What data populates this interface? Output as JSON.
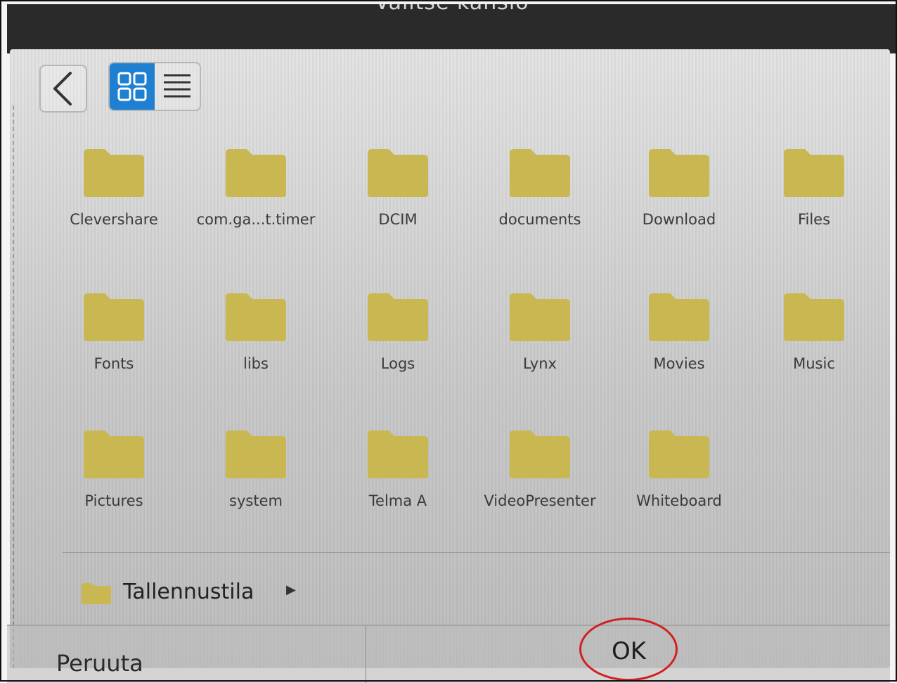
{
  "window": {
    "title": "Valitse kansio"
  },
  "toolbar": {
    "back_icon": "chevron-left-icon",
    "grid_view_icon": "grid-icon",
    "list_view_icon": "list-icon",
    "active_view": "grid"
  },
  "folders": [
    "Clevershare",
    "com.ga...t.timer",
    "DCIM",
    "documents",
    "Download",
    "Files",
    "Fonts",
    "libs",
    "Logs",
    "Lynx",
    "Movies",
    "Music",
    "Pictures",
    "system",
    "Telma A",
    "VideoPresenter",
    "Whiteboard"
  ],
  "path_bar": {
    "label": "Tallennustila",
    "icon": "folder-icon"
  },
  "footer": {
    "cancel_label": "Peruuta",
    "ok_label": "OK"
  },
  "colors": {
    "folder": "#c9b851",
    "accent": "#1f7fd0",
    "highlight_circle": "#d22020"
  }
}
